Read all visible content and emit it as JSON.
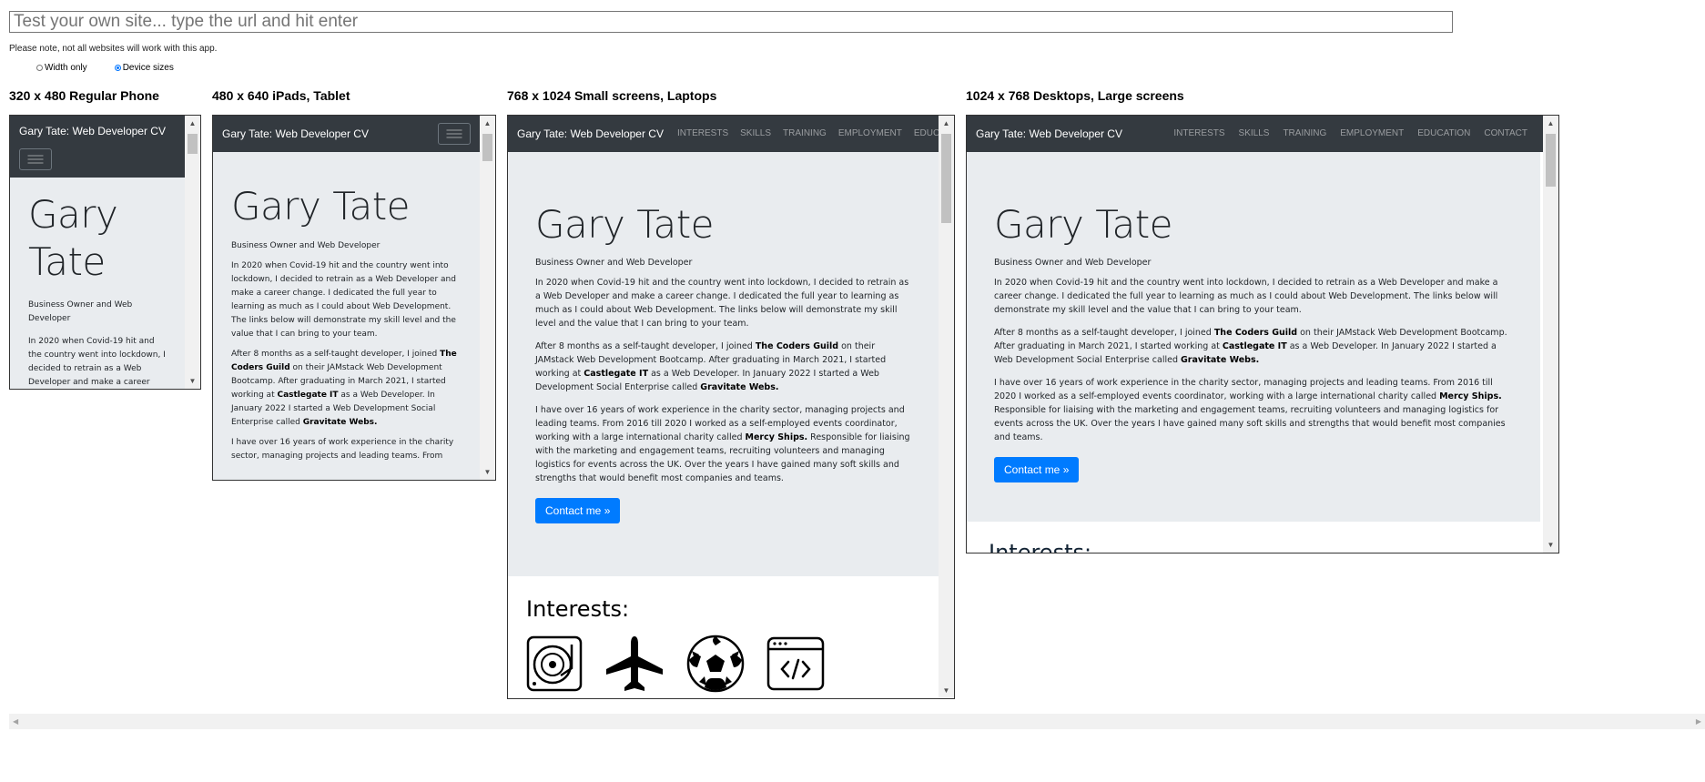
{
  "url_input": {
    "placeholder": "Test your own site... type the url and hit enter",
    "value": ""
  },
  "note": "Please note, not all websites will work with this app.",
  "radios": [
    {
      "label": "Width only",
      "checked": false
    },
    {
      "label": "Device sizes",
      "checked": true
    }
  ],
  "devices": [
    {
      "label": "320 x 480 Regular Phone"
    },
    {
      "label": "480 x 640 iPads, Tablet"
    },
    {
      "label": "768 x 1024 Small screens, Laptops"
    },
    {
      "label": "1024 x 768 Desktops, Large screens"
    }
  ],
  "site": {
    "brand": "Gary Tate: Web Developer CV",
    "nav": [
      "INTERESTS",
      "SKILLS",
      "TRAINING",
      "EMPLOYMENT",
      "EDUCATION",
      "CONTACT"
    ],
    "nav_truncated_laptop": "EDUCATIC",
    "heading": "Gary Tate",
    "heading_first": "Gary",
    "heading_last": "Tate",
    "subtitle": "Business Owner and Web Developer",
    "p1": "In 2020 when Covid-19 hit and the country went into lockdown, I decided to retrain as a Web Developer and make a career change. I dedicated the full year to learning as much as I could about Web Development. The links below will demonstrate my skill level and the value that I can bring to your team.",
    "p1_phone": "In 2020 when Covid-19 hit and the country went into lockdown, I decided to retrain as a Web Developer and make a career",
    "p2_a": "After 8 months as a self-taught developer, I joined ",
    "p2_b1": "The Coders Guild",
    "p2_c": " on their JAMstack Web Development Bootcamp. After graduating in March 2021, I started working at ",
    "p2_b2": "Castlegate IT",
    "p2_d": " as a Web Developer. In January 2022 I started a Web Development Social Enterprise called ",
    "p2_b3": "Gravitate Webs.",
    "p3_a": "I have over 16 years of work experience in the charity sector, managing projects and leading teams. From 2016 till 2020 I worked as a self-employed events coordinator, working with a large international charity called ",
    "p3_b": "Mercy Ships.",
    "p3_c": " Responsible for liaising with the marketing and engagement teams, recruiting volunteers and managing logistics for events across the UK. Over the years I have gained many soft skills and strengths that would benefit most companies and teams.",
    "p3_tablet": "I have over 16 years of work experience in the charity sector, managing projects and leading teams. From",
    "button": "Contact me »",
    "interests_heading": "Interests:",
    "interest_icons": [
      "turntable-icon",
      "airplane-icon",
      "football-icon",
      "code-window-icon"
    ]
  },
  "colors": {
    "navbar": "#343a40",
    "jumbotron": "#e9ecef",
    "button": "#007bff"
  }
}
